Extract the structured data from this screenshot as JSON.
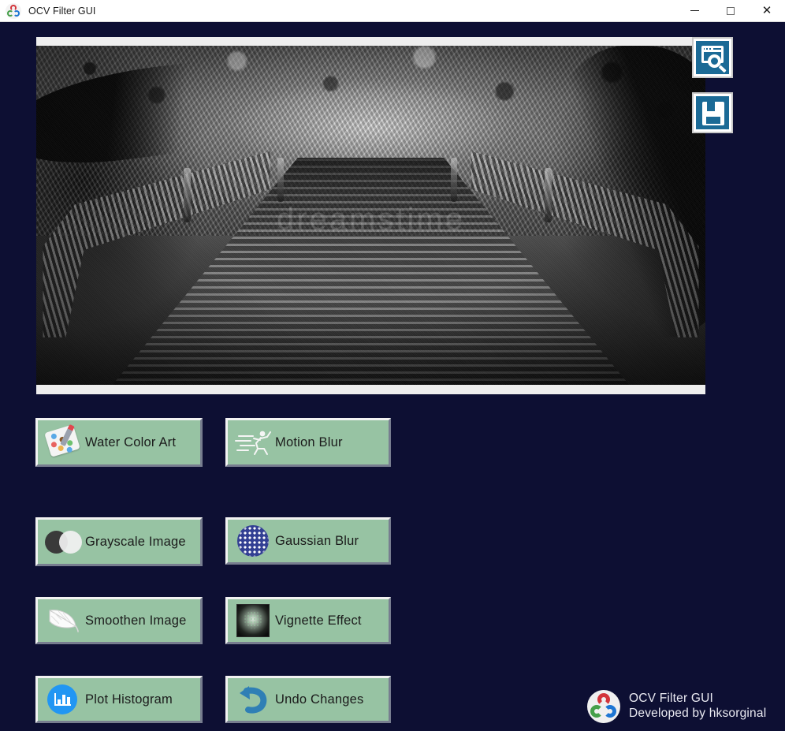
{
  "window": {
    "title": "OCV Filter GUI",
    "icon": "opencv-logo-icon",
    "controls": {
      "minimize": "minimize-icon",
      "maximize": "maximize-icon",
      "close": "close-icon"
    }
  },
  "preview": {
    "image_description": "Grayscale photo of a mossy wooden bridge in a forest",
    "watermark": "dreamstime"
  },
  "toolbar": {
    "browse_label": "browse-image",
    "browse_icon": "window-search-icon",
    "save_label": "save-image",
    "save_icon": "floppy-disk-icon"
  },
  "filters": [
    {
      "id": "water-color-art",
      "label": "Water Color Art",
      "icon": "palette-icon"
    },
    {
      "id": "motion-blur",
      "label": "Motion Blur",
      "icon": "running-man-icon"
    },
    {
      "id": "grayscale-image",
      "label": "Grayscale Image",
      "icon": "two-circles-icon"
    },
    {
      "id": "gaussian-blur",
      "label": "Gaussian Blur",
      "icon": "dotted-disc-icon"
    },
    {
      "id": "smoothen-image",
      "label": "Smoothen Image",
      "icon": "feather-icon"
    },
    {
      "id": "vignette-effect",
      "label": "Vignette Effect",
      "icon": "vignette-square-icon"
    },
    {
      "id": "plot-histogram",
      "label": "Plot Histogram",
      "icon": "bar-chart-icon"
    },
    {
      "id": "undo-changes",
      "label": "Undo Changes",
      "icon": "undo-arrow-icon"
    }
  ],
  "branding": {
    "logo": "opencv-logo-icon",
    "title": "OCV Filter GUI",
    "subtitle": "Developed by hksorginal"
  },
  "colors": {
    "background": "#0d0f33",
    "button_face": "#97c3a3",
    "tool_icon_blue": "#1b6a96",
    "titlebar": "#ffffff"
  }
}
